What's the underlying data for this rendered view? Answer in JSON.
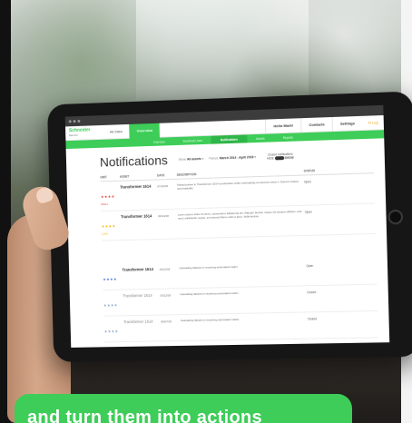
{
  "app": {
    "logo_line1": "Schneider",
    "logo_line2": "Electric",
    "nav": [
      "All Sites",
      "Overview"
    ],
    "nav_right": [
      "Hello Mark!",
      "Contacts",
      "Settings",
      "Log"
    ]
  },
  "subnav": [
    "Overview",
    "Electrical Lines",
    "Notifications",
    "Assets",
    "Reports"
  ],
  "page": {
    "title": "Notifications",
    "filter_show_label": "Show",
    "filter_show_value": "All assets",
    "filter_period_label": "Period:",
    "filter_period_value": "March 2014 - April 2018",
    "toggle_label": "Closed notifications",
    "toggle_left": "HIDE",
    "toggle_right": "SHOW"
  },
  "table": {
    "headers": [
      "UNIT",
      "ASSET",
      "DATE",
      "DESCRIPTION",
      "STATUS"
    ],
    "rows": [
      {
        "stars": "★★★★",
        "sev": "HIGH",
        "asset": "Transformer 1614",
        "date": "07/16/18",
        "desc": "Partial pulses in Transformer 1614 combination while overloading component since it. Doesn't reduce automatically.",
        "status": "Open",
        "color": "#e8392f",
        "muted": false
      },
      {
        "stars": "★★★★",
        "sev": "LOW",
        "asset": "Transformer 1614",
        "date": "06/14/18",
        "desc": "Lorem ipsum dolor sit amet, consectetur adipiscing elit. Aliquam lacinia, neque vel semper efficitur, erat nunc sollicitudin neque, at euismod libero velit ut arcu. Nulla lacinia.",
        "status": "Open",
        "color": "#f0b400",
        "muted": false
      },
      {
        "stars": "★★★★",
        "sev": "",
        "asset": "Transformer 1614",
        "date": "03/12/18",
        "desc": "Cascading failures in receiving automated matrix.",
        "status": "Open",
        "color": "#3a6fd8",
        "muted": false
      },
      {
        "stars": "★★★★",
        "sev": "",
        "asset": "Transformer 1614",
        "date": "03/12/18",
        "desc": "Cascading failures in receiving automated matrix.",
        "status": "Closed",
        "color": "#8aa0c8",
        "muted": true
      },
      {
        "stars": "★★★★",
        "sev": "",
        "asset": "Transformer 1614",
        "date": "09/07/18",
        "desc": "Cascading failures in receiving automated matrix.",
        "status": "Closed",
        "color": "#8aa0c8",
        "muted": true
      }
    ]
  },
  "banner": {
    "text": "and turn them into actions"
  },
  "colors": {
    "brand_green": "#3dcd58"
  }
}
